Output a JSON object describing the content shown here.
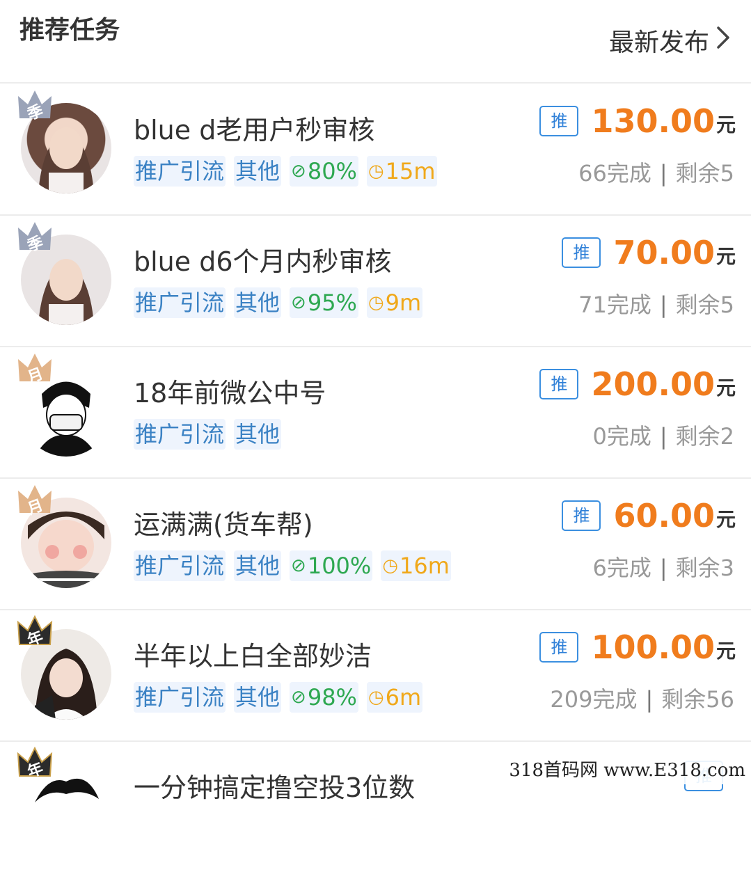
{
  "header": {
    "title": "推荐任务",
    "latest_label": "最新发布",
    "chevron_icon": "chevron-right-icon"
  },
  "tasks": [
    {
      "crown": "季",
      "crown_color": "#9aa3b8",
      "title": "blue d老用户秒审核",
      "tags": {
        "cat1": "推广引流",
        "cat2": "其他",
        "rate": "80%",
        "time": "15m"
      },
      "badge": "推",
      "price": "130.00",
      "unit": "元",
      "done": "66完成",
      "remain": "剩余5"
    },
    {
      "crown": "季",
      "crown_color": "#9aa3b8",
      "title": "blue d6个月内秒审核",
      "tags": {
        "cat1": "推广引流",
        "cat2": "其他",
        "rate": "95%",
        "time": "9m"
      },
      "badge": "推",
      "price": "70.00",
      "unit": "元",
      "done": "71完成",
      "remain": "剩余5"
    },
    {
      "crown": "月",
      "crown_color": "#e2b48a",
      "title": "18年前微公中号",
      "tags": {
        "cat1": "推广引流",
        "cat2": "其他"
      },
      "badge": "推",
      "price": "200.00",
      "unit": "元",
      "done": "0完成",
      "remain": "剩余2"
    },
    {
      "crown": "月",
      "crown_color": "#e2b48a",
      "title": "运满满(货车帮)",
      "tags": {
        "cat1": "推广引流",
        "cat2": "其他",
        "rate": "100%",
        "time": "16m"
      },
      "badge": "推",
      "price": "60.00",
      "unit": "元",
      "done": "6完成",
      "remain": "剩余3"
    },
    {
      "crown": "年",
      "crown_color": "#2b2b2b",
      "title": "半年以上白全部妙洁",
      "tags": {
        "cat1": "推广引流",
        "cat2": "其他",
        "rate": "98%",
        "time": "6m"
      },
      "badge": "推",
      "price": "100.00",
      "unit": "元",
      "done": "209完成",
      "remain": "剩余56"
    },
    {
      "crown": "年",
      "crown_color": "#2b2b2b",
      "title": "一分钟搞定撸空投3位数",
      "badge": "推"
    }
  ],
  "colors": {
    "price": "#f07c1d",
    "tag_blue": "#3b82c4",
    "tag_green": "#2ea851",
    "tag_orange": "#f0a81a",
    "badge": "#2f80d8"
  },
  "icons": {
    "rate": "check-circle-icon",
    "time": "clock-icon"
  },
  "watermark": "318首码网 www.E318.com"
}
